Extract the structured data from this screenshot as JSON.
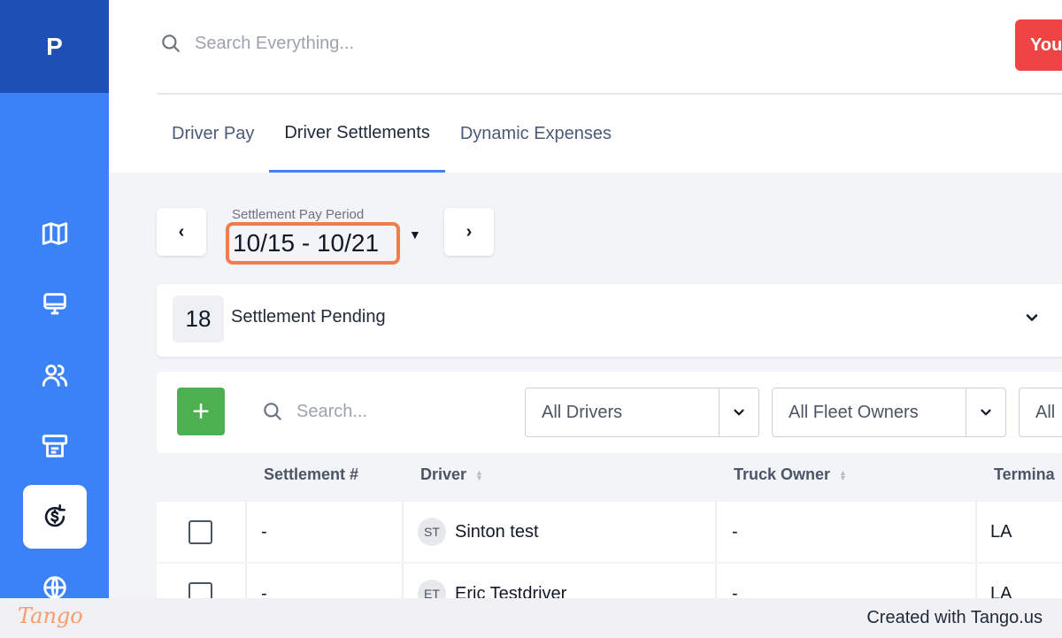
{
  "sidebar": {
    "logo": "P",
    "items": [
      {
        "icon": "map-icon"
      },
      {
        "icon": "monitor-icon"
      },
      {
        "icon": "users-icon"
      },
      {
        "icon": "receipt-icon"
      },
      {
        "icon": "settlement-dollar-icon",
        "active": true
      },
      {
        "icon": "globe-icon"
      }
    ]
  },
  "header": {
    "search_placeholder": "Search Everything...",
    "user_button": "You",
    "tabs": [
      {
        "label": "Driver Pay"
      },
      {
        "label": "Driver Settlements",
        "active": true
      },
      {
        "label": "Dynamic Expenses"
      }
    ]
  },
  "period": {
    "prev": "‹",
    "next": "›",
    "label": "Settlement Pay Period",
    "value": "10/15 - 10/21"
  },
  "pending": {
    "count": "18",
    "label": "Settlement Pending"
  },
  "toolbar": {
    "add": "+",
    "search_placeholder": "Search...",
    "filters": [
      "All Drivers",
      "All Fleet Owners",
      "All"
    ]
  },
  "table": {
    "headers": [
      "Settlement #",
      "Driver",
      "Truck Owner",
      "Termina"
    ],
    "rows": [
      {
        "settlement": "-",
        "initials": "ST",
        "driver": "Sinton test",
        "owner": "-",
        "terminal": "LA"
      },
      {
        "settlement": "-",
        "initials": "ET",
        "driver": "Eric Testdriver",
        "owner": "-",
        "terminal": "LA"
      }
    ]
  },
  "footer": {
    "logo": "Tango",
    "text": "Created with Tango.us"
  },
  "colors": {
    "sidebar": "#3b82f6",
    "sidebar_logo_bg": "#1e4fb5",
    "highlight": "#f37c4b",
    "add_button": "#4caf50",
    "user_button": "#ef4444"
  }
}
